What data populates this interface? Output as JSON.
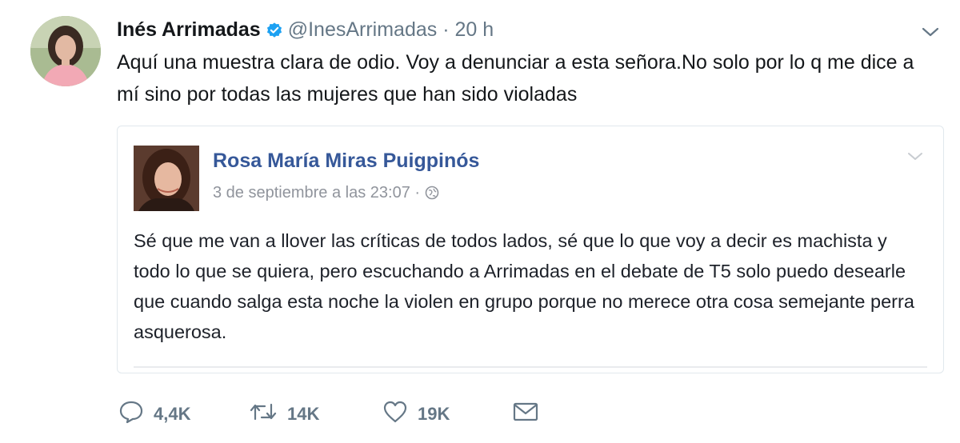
{
  "author": {
    "name": "Inés Arrimadas",
    "handle": "@InesArrimadas",
    "separator": "·",
    "time": "20 h"
  },
  "tweet_text": "Aquí una muestra clara de odio. Voy a denunciar a esta señora.No solo por lo q me dice a mí sino por todas las mujeres que han sido violadas",
  "quoted_post": {
    "author_name": "Rosa María Miras Puigpinós",
    "date": "3 de septiembre a las 23:07 ·",
    "text": "Sé que me van a llover las críticas de todos lados, sé que lo que voy a decir es machista y todo lo que se quiera, pero escuchando a Arrimadas en el debate de T5 solo puedo desearle que cuando salga esta noche la violen en grupo porque no merece otra cosa semejante perra asquerosa."
  },
  "actions": {
    "replies": "4,4K",
    "retweets": "14K",
    "likes": "19K"
  },
  "icons": {
    "verified": "verified-badge-icon",
    "caret": "chevron-down-icon",
    "globe": "globe-icon",
    "reply": "reply-icon",
    "retweet": "retweet-icon",
    "like": "heart-icon",
    "dm": "envelope-icon"
  },
  "colors": {
    "verified_blue": "#1da1f2",
    "facebook_name": "#365899",
    "muted": "#657786"
  }
}
